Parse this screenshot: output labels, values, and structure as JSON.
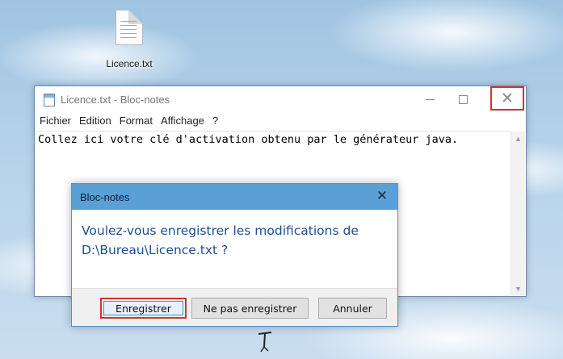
{
  "desktop": {
    "icon_label": "Licence.txt",
    "icon_name": "text-file-icon"
  },
  "notepad": {
    "title": "Licence.txt - Bloc-notes",
    "menu": [
      "Fichier",
      "Edition",
      "Format",
      "Affichage",
      "?"
    ],
    "content": "Collez ici votre clé d'activation obtenu par le générateur java.",
    "close_glyph": "✕",
    "highlight_color": "#d0352c"
  },
  "dialog": {
    "title": "Bloc-notes",
    "message_line1": "Voulez-vous enregistrer les modifications de",
    "message_line2": "D:\\Bureau\\Licence.txt ?",
    "close_glyph": "✕",
    "buttons": {
      "save": "Enregistrer",
      "dont_save": "Ne pas enregistrer",
      "cancel": "Annuler"
    },
    "title_color": "#5aa0d6",
    "message_color": "#1c4e97"
  }
}
